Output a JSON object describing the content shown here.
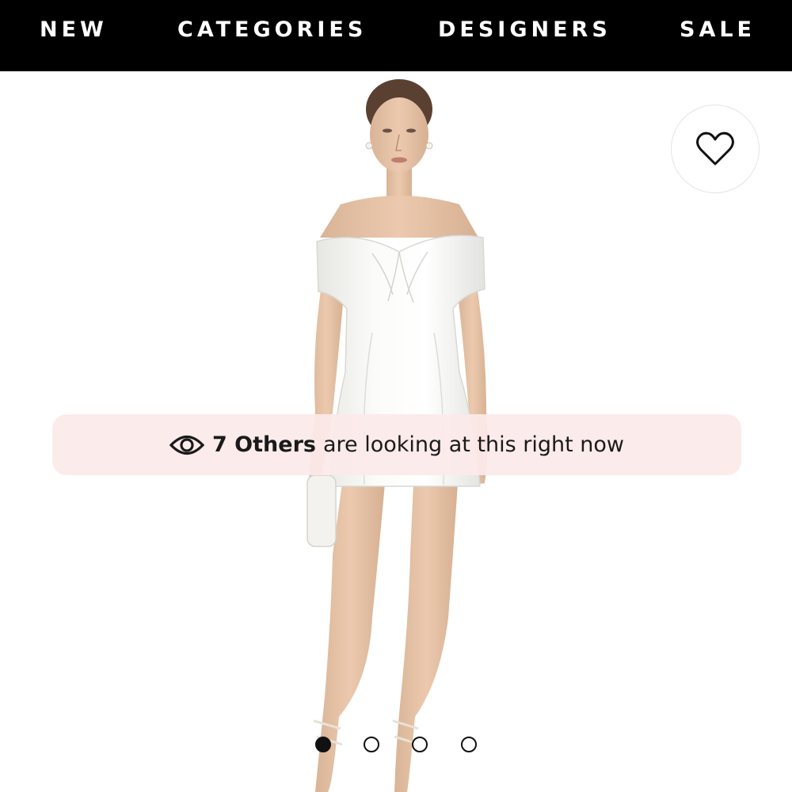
{
  "nav": {
    "items": [
      {
        "label": "NEW"
      },
      {
        "label": "CATEGORIES"
      },
      {
        "label": "DESIGNERS"
      },
      {
        "label": "SALE"
      }
    ]
  },
  "product": {
    "image_subject": "model in white off-shoulder satin mini dress with white clutch",
    "wishlist_icon": "heart-outline-icon"
  },
  "viewers_banner": {
    "icon": "eye-icon",
    "count_text": "7 Others",
    "rest_text": "are looking at this right now",
    "background": "#fcebeb"
  },
  "carousel": {
    "total": 4,
    "active_index": 0
  },
  "colors": {
    "nav_background": "#000000",
    "nav_text": "#ffffff",
    "banner_text": "#1a1a1a"
  }
}
